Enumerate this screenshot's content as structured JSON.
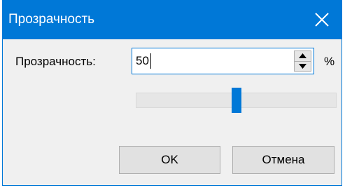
{
  "window": {
    "title": "Прозрачность",
    "close_icon": "close-icon",
    "accent_color": "#0078d7"
  },
  "transparency": {
    "label": "Прозрачность:",
    "value": "50",
    "unit": "%",
    "slider_level_percent": 50
  },
  "buttons": {
    "ok_label": "OK",
    "cancel_label": "Отмена"
  }
}
